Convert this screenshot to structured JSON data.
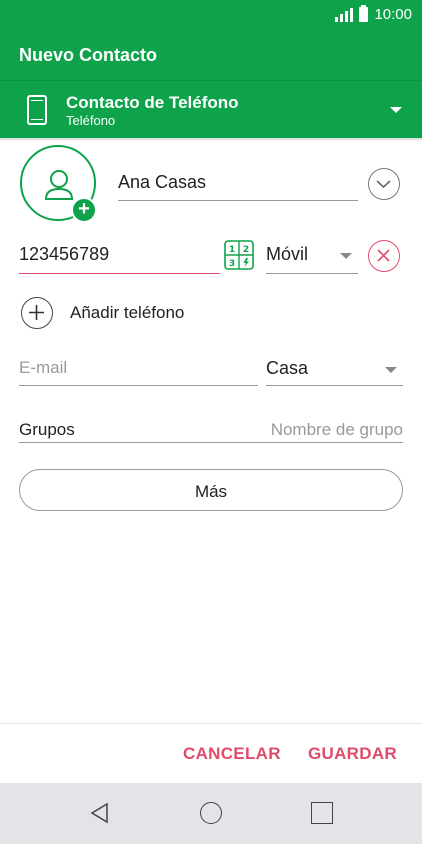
{
  "status_bar": {
    "time": "10:00",
    "icons": [
      "signal-icon",
      "battery-icon"
    ]
  },
  "app_bar": {
    "title": "Nuevo Contacto"
  },
  "account": {
    "title": "Contacto de Teléfono",
    "subtitle": "Teléfono",
    "icon": "phone-icon"
  },
  "form": {
    "name_value": "Ana Casas",
    "phone_value": "123456789",
    "phone_type": "Móvil",
    "add_phone_label": "Añadir teléfono",
    "email_placeholder": "E-mail",
    "email_type": "Casa",
    "groups_label": "Grupos",
    "groups_placeholder": "Nombre de grupo",
    "more_label": "Más"
  },
  "footer": {
    "cancel_label": "CANCELAR",
    "save_label": "GUARDAR"
  },
  "colors": {
    "primary": "#0ea34a",
    "accent": "#e14b6b"
  },
  "nav": {
    "icons": [
      "back-icon",
      "home-icon",
      "recents-icon"
    ]
  }
}
